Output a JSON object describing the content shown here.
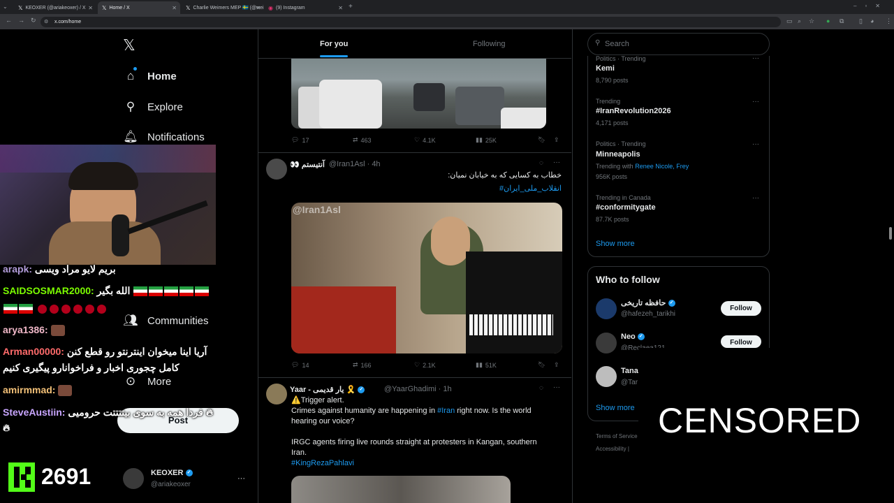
{
  "browser": {
    "tabs": [
      {
        "title": "KEOXER (@ariakeoxer) / X"
      },
      {
        "title": "Home / X"
      },
      {
        "title": "Charlie Weimers MEP 🇸🇪 (@wei"
      },
      {
        "title": "(9) Instagram"
      }
    ],
    "url": "x.com/home"
  },
  "sidebar": {
    "logo": "𝕏",
    "items": [
      {
        "label": "Home"
      },
      {
        "label": "Explore"
      },
      {
        "label": "Notifications"
      },
      {
        "label": "Communities"
      },
      {
        "label": "More"
      }
    ],
    "post_label": "Post",
    "account": {
      "name": "KEOXER",
      "handle": "@ariakeoxer"
    }
  },
  "feed": {
    "tabs": [
      {
        "label": "For you"
      },
      {
        "label": "Following"
      }
    ],
    "posts": [
      {
        "metrics": {
          "replies": "17",
          "reposts": "463",
          "likes": "4.1K",
          "views": "25K"
        }
      },
      {
        "name": "👀 آنتیستم",
        "handle": "@Iran1Asl",
        "time": "· 4h",
        "text": "خطاب به کسایی که به خیابان نمیان:",
        "hashtag": "#انقلاب_ملی_ایران",
        "watermark": "@Iran1Asl",
        "metrics": {
          "replies": "14",
          "reposts": "166",
          "likes": "2.1K",
          "views": "51K"
        }
      },
      {
        "name": "Yaar - یار قدیمی 🎗️",
        "handle": "@YaarGhadimi",
        "time": "· 1h",
        "line1": "⚠️Trigger alert.",
        "line2a": "Crimes against humanity are happening in ",
        "line2tag": "#Iran",
        "line2b": " right now. Is the world",
        "line3": "hearing our voice?",
        "line4": "IRGC agents firing live rounds straight at protesters in Kangan, southern",
        "line5": "Iran.",
        "hashtag": "#KingRezaPahlavi"
      }
    ]
  },
  "right": {
    "search_placeholder": "Search",
    "trends": [
      {
        "context": "Politics · Trending",
        "name": "Kemi",
        "posts": "8,790 posts"
      },
      {
        "context": "Trending",
        "name": "#IranRevolution2026",
        "posts": "4,171 posts"
      },
      {
        "context": "Politics · Trending",
        "name": "Minneapolis",
        "with_label": "Trending with",
        "with_names": "Renee Nicole, Frey",
        "posts": "956K posts"
      },
      {
        "context": "Trending in Canada",
        "name": "#conformitygate",
        "posts": "87.7K posts"
      }
    ],
    "show_more": "Show more",
    "who_to_follow": {
      "title": "Who to follow",
      "people": [
        {
          "name": "حافظه تاریخی",
          "handle": "@hafezeh_tarikhi",
          "button": "Follow"
        },
        {
          "name": "Neo",
          "handle": "@Reclaea121",
          "button": "Follow"
        },
        {
          "name": "Tana",
          "handle": "@Tar"
        }
      ],
      "show_more": "Show more"
    },
    "footer": {
      "terms": "Terms of Service",
      "accessibility": "Accessibility",
      "sep": "|"
    }
  },
  "stream_overlay": {
    "chat": [
      {
        "user": "arapk:",
        "user_color": "#b39ddb",
        "msg": "بریم لایو مراد ویسی"
      },
      {
        "user": "SAIDSOSMAR2000:",
        "user_color": "#7cfc00",
        "msg": "الله بگیر"
      },
      {
        "user": "arya1386:",
        "user_color": "#f0b8c8",
        "msg": ""
      },
      {
        "user": "Arman00000:",
        "user_color": "#ff6b6b",
        "msg": "آریا اینا میخوان اینترنتو رو قطع کنن",
        "msg2": "کامل چجوری اخبار و فراخوانارو پیگیری کنیم"
      },
      {
        "user": "amirmmad:",
        "user_color": "#f3c178",
        "msg": ""
      },
      {
        "user": "SteveAustiin:",
        "user_color": "#c9a6ff",
        "msg": "فردا همه به سوی بیتتتتت حرومیی"
      }
    ],
    "kick_count": "2691",
    "censored": "CENSORED"
  }
}
